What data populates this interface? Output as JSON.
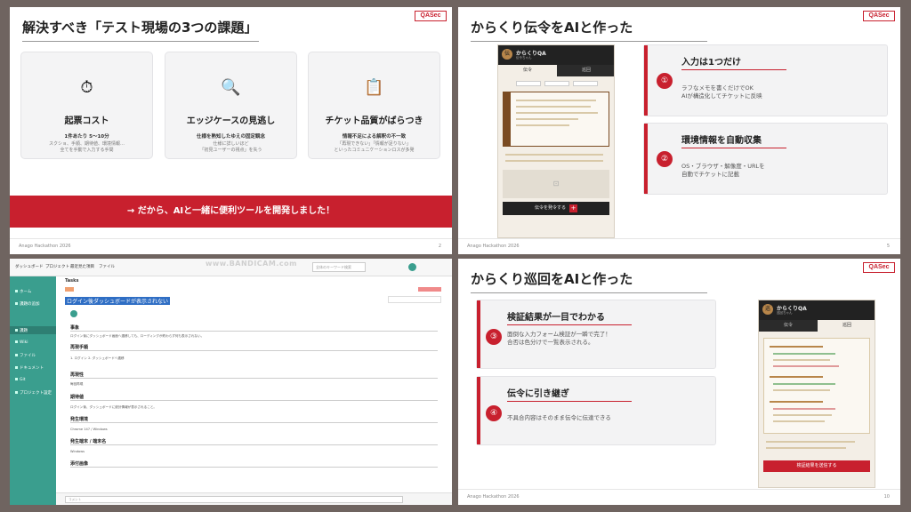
{
  "slide1": {
    "badge": "QASec",
    "title": "解決すべき「テスト現場の3つの課題」",
    "cards": [
      {
        "icon": "⏱",
        "heading": "起票コスト",
        "sub": "1件あたり 5〜10分",
        "desc1": "スクショ、手順、期待値、環境情報…",
        "desc2": "全てを手動で入力する手間"
      },
      {
        "icon": "🔍",
        "heading": "エッジケースの見逃し",
        "sub": "仕様を熟知したゆえの固定観念",
        "desc1": "仕様に詳しいほど",
        "desc2": "「初見ユーザーの視点」を失う"
      },
      {
        "icon": "📋",
        "heading": "チケット品質がばらつき",
        "sub": "情報不足による解釈の不一致",
        "desc1": "「再現できない」「情報が足りない」",
        "desc2": "といったコミュニケーションロスが多発"
      }
    ],
    "banner": "→ だから、AIと一緒に便利ツールを開発しました！",
    "footer": "Anago Hackathon 2026",
    "page": "2"
  },
  "slide2": {
    "badge": "QASec",
    "title": "からくり伝令をAIと作った",
    "phone": {
      "logo": "伝",
      "name": "からくりQA",
      "sub": "伝令ちゃん",
      "tab_active": "伝令",
      "tab_other": "巡回",
      "button": "伝令を発令する"
    },
    "features": [
      {
        "num": "①",
        "heading": "入力は1つだけ",
        "line1": "ラフなメモを書くだけでOK",
        "line2": "AIが構造化してチケットに反映"
      },
      {
        "num": "②",
        "heading": "環境情報を自動収集",
        "line1": "OS・ブラウザ・解像度・URLを",
        "line2": "自動でチケットに記載"
      }
    ],
    "footer": "Anago Hackathon 2026",
    "page": "5"
  },
  "slide3": {
    "watermark": "www.BANDICAM.com",
    "nav": [
      "ダッシュボード",
      "プロジェクト",
      "最近見た項目",
      "ファイル"
    ],
    "search_placeholder": "全体のキーワード検索",
    "sidebar": [
      "ホーム",
      "課題の追加",
      "課題",
      "Wiki",
      "ファイル",
      "ドキュメント",
      "Git",
      "プロジェクト設定"
    ],
    "breadcrumb": "Tasks",
    "ticket_title": "ログイン後ダッシュボードが表示されない",
    "sections": [
      {
        "h": "事象",
        "t": "ログイン後にダッシュボード画面へ遷移しても、ローディングが終わらず何も表示されない。"
      },
      {
        "h": "再現手順",
        "t": "1. ログイン  2. ダッシュボードへ遷移"
      },
      {
        "h": "再現性",
        "t": "毎回再現"
      },
      {
        "h": "期待値",
        "t": "ログイン後、ダッシュボードに統計情報が表示されること。"
      },
      {
        "h": "発生環境",
        "t": "Chrome 147 / Windows"
      },
      {
        "h": "発生端末 / 端末名",
        "t": "Windows"
      },
      {
        "h": "添付画像",
        "t": ""
      }
    ],
    "comment_placeholder": "コメント"
  },
  "slide4": {
    "badge": "QASec",
    "title": "からくり巡回をAIと作った",
    "phone": {
      "logo": "巡",
      "name": "からくりQA",
      "sub": "巡回ちゃん",
      "tab_active": "巡回",
      "tab_other": "伝令",
      "button": "検証結果を送信する"
    },
    "features": [
      {
        "num": "③",
        "heading": "検証結果が一目でわかる",
        "line1": "面倒な入力フォーム検証が一瞬で完了！",
        "line2": "合否は色分けで一覧表示される。"
      },
      {
        "num": "④",
        "heading": "伝令に引き継ぎ",
        "line1": "不具合内容はそのまま伝令に伝達できる",
        "line2": ""
      }
    ],
    "footer": "Anago Hackathon 2026",
    "page": "10"
  }
}
